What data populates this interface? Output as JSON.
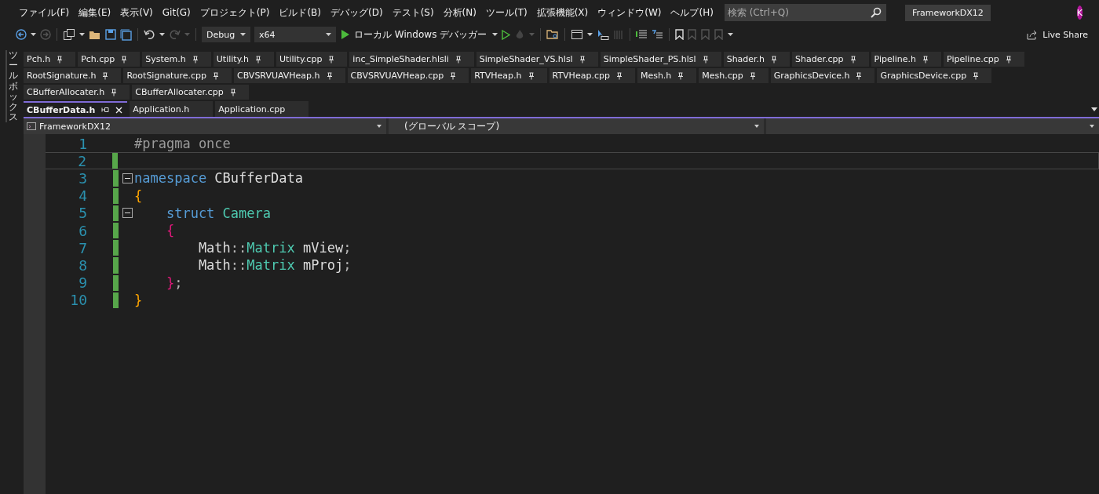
{
  "menu": [
    "ファイル(F)",
    "編集(E)",
    "表示(V)",
    "Git(G)",
    "プロジェクト(P)",
    "ビルド(B)",
    "デバッグ(D)",
    "テスト(S)",
    "分析(N)",
    "ツール(T)",
    "拡張機能(X)",
    "ウィンドウ(W)",
    "ヘルプ(H)"
  ],
  "search": {
    "placeholder": "検索 (Ctrl+Q)"
  },
  "solution_name": "FrameworkDX12",
  "account": {
    "initial": "K"
  },
  "toolbar": {
    "configuration": "Debug",
    "platform": "x64",
    "run_target": "ローカル Windows デバッガー",
    "live_share": "Live Share"
  },
  "toolbox_label": "ツールボックス",
  "pinned_tab_rows": [
    [
      "Pch.h",
      "Pch.cpp",
      "System.h",
      "Utility.h",
      "Utility.cpp",
      "inc_SimpleShader.hlsli",
      "SimpleShader_VS.hlsl",
      "SimpleShader_PS.hlsl",
      "Shader.h",
      "Shader.cpp",
      "Pipeline.h",
      "Pipeline.cpp"
    ],
    [
      "RootSignature.h",
      "RootSignature.cpp",
      "CBVSRVUAVHeap.h",
      "CBVSRVUAVHeap.cpp",
      "RTVHeap.h",
      "RTVHeap.cpp",
      "Mesh.h",
      "Mesh.cpp",
      "GraphicsDevice.h",
      "GraphicsDevice.cpp"
    ],
    [
      "CBufferAllocater.h",
      "CBufferAllocater.cpp"
    ]
  ],
  "open_tabs": [
    {
      "label": "CBufferData.h",
      "selected": true
    },
    {
      "label": "Application.h",
      "selected": false
    },
    {
      "label": "Application.cpp",
      "selected": false
    }
  ],
  "navigation_bar": {
    "project": "FrameworkDX12",
    "scope": "(グローバル スコープ)"
  },
  "code_lines": [
    {
      "number": "1",
      "changed": false,
      "fold": false,
      "current": false,
      "tokens": [
        {
          "kind": "preproc",
          "text": "#pragma once"
        }
      ]
    },
    {
      "number": "2",
      "changed": true,
      "fold": false,
      "current": true
    },
    {
      "number": "3",
      "changed": true,
      "fold": true,
      "current": false,
      "tokens": [
        {
          "kind": "keyword",
          "text": "namespace"
        },
        {
          "kind": "plain",
          "text": " CBufferData"
        }
      ]
    },
    {
      "number": "4",
      "changed": true,
      "fold": false,
      "current": false,
      "tokens": [
        {
          "kind": "brace1",
          "text": "{"
        }
      ]
    },
    {
      "number": "5",
      "changed": true,
      "fold": true,
      "current": false,
      "tokens": [
        {
          "kind": "keyword",
          "text": "    struct"
        },
        {
          "kind": "type",
          "text": " Camera"
        }
      ]
    },
    {
      "number": "6",
      "changed": true,
      "fold": false,
      "current": false,
      "tokens": [
        {
          "kind": "brace2",
          "text": "    {"
        }
      ]
    },
    {
      "number": "7",
      "changed": true,
      "fold": false,
      "current": false,
      "tokens": [
        {
          "kind": "plain",
          "text": "        Math"
        },
        {
          "kind": "punct",
          "text": "::"
        },
        {
          "kind": "type",
          "text": "Matrix"
        },
        {
          "kind": "plain",
          "text": " mView"
        },
        {
          "kind": "punct",
          "text": ";"
        }
      ]
    },
    {
      "number": "8",
      "changed": true,
      "fold": false,
      "current": false,
      "tokens": [
        {
          "kind": "plain",
          "text": "        Math"
        },
        {
          "kind": "punct",
          "text": "::"
        },
        {
          "kind": "type",
          "text": "Matrix"
        },
        {
          "kind": "plain",
          "text": " mProj"
        },
        {
          "kind": "punct",
          "text": ";"
        }
      ]
    },
    {
      "number": "9",
      "changed": true,
      "fold": false,
      "current": false,
      "tokens": [
        {
          "kind": "brace2",
          "text": "    }"
        },
        {
          "kind": "punct",
          "text": ";"
        }
      ]
    },
    {
      "number": "10",
      "changed": true,
      "fold": false,
      "current": false,
      "tokens": [
        {
          "kind": "brace1",
          "text": "}"
        }
      ]
    }
  ]
}
